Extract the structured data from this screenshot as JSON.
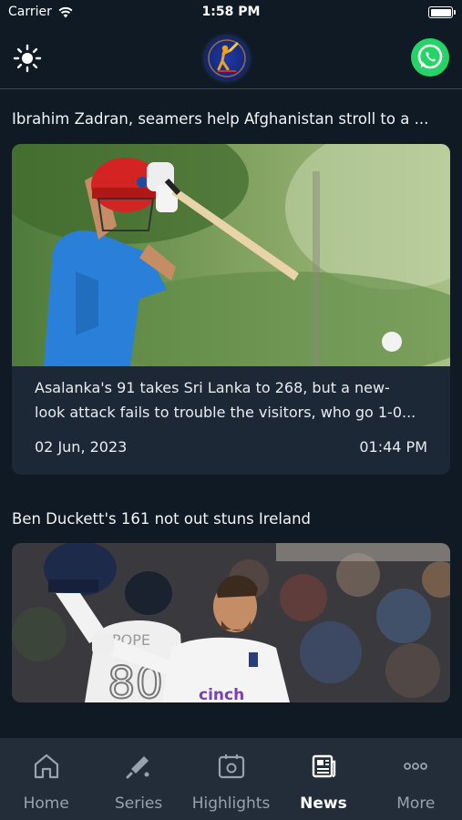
{
  "status_bar": {
    "carrier": "Carrier",
    "time": "1:58 PM"
  },
  "header": {
    "theme_icon": "sun-icon",
    "logo_icon": "cricket-batsman-logo",
    "whatsapp_icon": "whatsapp-icon"
  },
  "articles": [
    {
      "title": "Ibrahim Zadran, seamers help Afghanistan stroll to a ...",
      "summary_line1": "Asalanka's 91 takes Sri Lanka to 268, but a new-",
      "summary_line2": "look attack fails to trouble the visitors, who go 1-0...",
      "date": "02 Jun, 2023",
      "time": "01:44 PM",
      "image": "afghanistan-batsman-photo"
    },
    {
      "title": "Ben Duckett's 161 not out stuns Ireland",
      "image": "england-batsman-celebration-photo",
      "image_text": "cinch"
    }
  ],
  "tabs": [
    {
      "label": "Home",
      "icon": "home-icon"
    },
    {
      "label": "Series",
      "icon": "cricket-bat-icon"
    },
    {
      "label": "Highlights",
      "icon": "video-calendar-icon"
    },
    {
      "label": "News",
      "icon": "newspaper-icon"
    },
    {
      "label": "More",
      "icon": "more-dots-icon"
    }
  ],
  "active_tab": "News",
  "colors": {
    "background": "#0f1a24",
    "card": "#1c2835",
    "tab_bar": "#222d39",
    "whatsapp": "#25d366"
  }
}
